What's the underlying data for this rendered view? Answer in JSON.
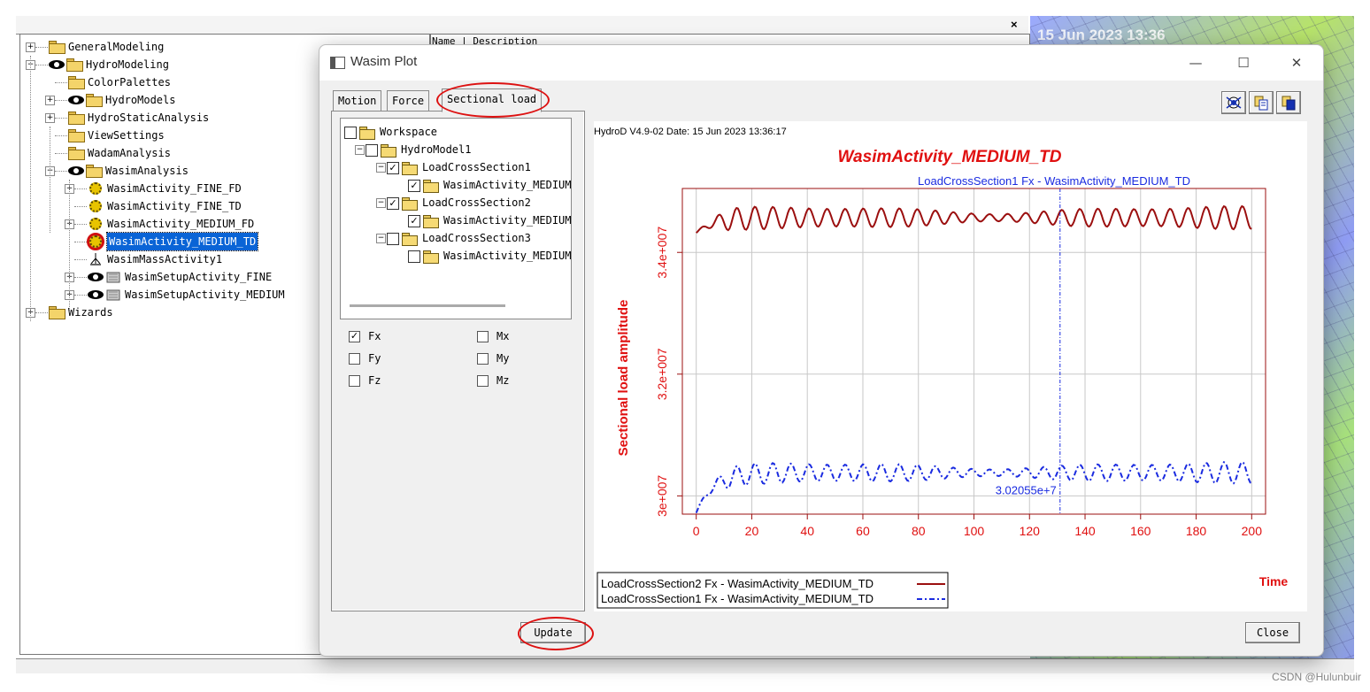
{
  "background": {
    "tree_items": [
      {
        "label": "GeneralModeling"
      },
      {
        "label": "HydroModeling"
      },
      {
        "label": "ColorPalettes"
      },
      {
        "label": "HydroModels"
      },
      {
        "label": "HydroStaticAnalysis"
      },
      {
        "label": "ViewSettings"
      },
      {
        "label": "WadamAnalysis"
      },
      {
        "label": "WasimAnalysis"
      },
      {
        "label": "WasimActivity_FINE_FD"
      },
      {
        "label": "WasimActivity_FINE_TD"
      },
      {
        "label": "WasimActivity_MEDIUM_FD"
      },
      {
        "label": "WasimActivity_MEDIUM_TD"
      },
      {
        "label": "WasimMassActivity1"
      },
      {
        "label": "WasimSetupActivity_FINE"
      },
      {
        "label": "WasimSetupActivity_MEDIUM"
      },
      {
        "label": "Wizards"
      }
    ],
    "mid_header": "Name | Description",
    "viewport_date": "15 Jun 2023 13:36",
    "close_mark": "×",
    "watermark": "CSDN @Hulunbuir"
  },
  "dialog": {
    "title": "Wasim Plot",
    "tabs": [
      {
        "label": "Motion"
      },
      {
        "label": "Force"
      },
      {
        "label": "Sectional load"
      }
    ],
    "active_tab": "Sectional load",
    "load_tree": [
      {
        "label": "Workspace",
        "checked": false
      },
      {
        "label": "HydroModel1",
        "checked": false
      },
      {
        "label": "LoadCrossSection1",
        "checked": true
      },
      {
        "label": "WasimActivity_MEDIUM_TD",
        "checked": true
      },
      {
        "label": "LoadCrossSection2",
        "checked": true
      },
      {
        "label": "WasimActivity_MEDIUM_TD",
        "checked": true
      },
      {
        "label": "LoadCrossSection3",
        "checked": false
      },
      {
        "label": "WasimActivity_MEDIUM_TD",
        "checked": false
      }
    ],
    "components": [
      {
        "label": "Fx",
        "checked": true
      },
      {
        "label": "Mx",
        "checked": false
      },
      {
        "label": "Fy",
        "checked": false
      },
      {
        "label": "My",
        "checked": false
      },
      {
        "label": "Fz",
        "checked": false
      },
      {
        "label": "Mz",
        "checked": false
      }
    ],
    "update_label": "Update",
    "close_label": "Close",
    "toolbar_icons": [
      "view-icon",
      "copy-icon",
      "copy-data-icon"
    ]
  },
  "chart_data": {
    "type": "line",
    "header": "HydroD V4.9-02 Date: 15 Jun 2023 13:36:17",
    "title": "WasimActivity_MEDIUM_TD",
    "cursor_label": "LoadCrossSection1 Fx - WasimActivity_MEDIUM_TD",
    "cursor_x": 131,
    "cursor_value": "3.02055e+7",
    "xlabel": "Time",
    "ylabel": "Sectional load amplitude",
    "xlim": [
      -5,
      205
    ],
    "ylim": [
      29700000,
      35050000
    ],
    "x_ticks": [
      "0",
      "20",
      "40",
      "60",
      "80",
      "100",
      "120",
      "140",
      "160",
      "180",
      "200"
    ],
    "y_ticks": [
      {
        "label": "3e+007",
        "value": 30000000
      },
      {
        "label": "3.2e+007",
        "value": 32000000
      },
      {
        "label": "3.4e+007",
        "value": 34000000
      }
    ],
    "grid": true,
    "legend_position": "bottom-left",
    "colors": {
      "series2": "#9b0f0f",
      "series1": "#1a2be0",
      "title": "#e01010",
      "axis": "#9b0f0f"
    },
    "series": [
      {
        "name": "LoadCrossSection2 Fx - WasimActivity_MEDIUM_TD",
        "style": "solid",
        "mean": 34570000,
        "amplitude": 130000,
        "start": 34320000,
        "period": 6.5
      },
      {
        "name": "LoadCrossSection1 Fx - WasimActivity_MEDIUM_TD",
        "style": "dash-dot",
        "mean": 30380000,
        "amplitude": 120000,
        "start": 29720000,
        "period": 6.5
      }
    ]
  }
}
